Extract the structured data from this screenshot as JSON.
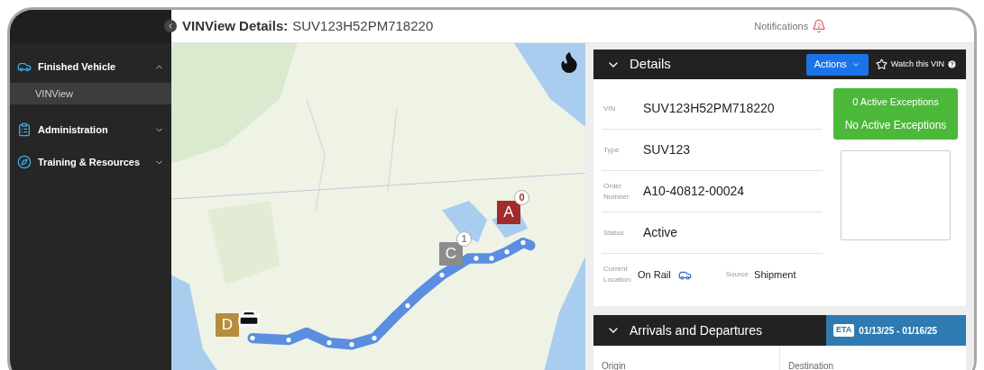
{
  "header": {
    "title": "VINView Details:",
    "vin": "SUV123H52PM718220",
    "notifications": "Notifications",
    "notification_count": "2"
  },
  "sidebar": {
    "items": [
      {
        "label": "Finished Vehicle",
        "expanded": true,
        "children": [
          {
            "label": "VINView",
            "selected": true
          }
        ]
      },
      {
        "label": "Administration",
        "expanded": false
      },
      {
        "label": "Training & Resources",
        "expanded": false
      }
    ]
  },
  "map": {
    "kind": "picture",
    "markers": [
      {
        "label": "A",
        "badge": "0",
        "color": "#a32b2b"
      },
      {
        "label": "C",
        "badge": "1",
        "color": "#8c8c8c"
      },
      {
        "label": "D",
        "color": "#b58d3d"
      }
    ]
  },
  "details": {
    "title": "Details",
    "actions": "Actions",
    "watch": "Watch this VIN",
    "watched": false,
    "fields": [
      {
        "label": "VIN",
        "value": "SUV123H52PM718220"
      },
      {
        "label": "Type",
        "value": "SUV123"
      },
      {
        "label": "Order Number",
        "value": "A10-40812-00024"
      },
      {
        "label": "Status",
        "value": "Active"
      }
    ],
    "current_location": {
      "label": "Current Location",
      "value": "On Rail"
    },
    "source": {
      "label": "Source",
      "value": "Shipment"
    },
    "exceptions": {
      "count": "0 Active Exceptions",
      "message": "No Active Exceptions"
    }
  },
  "arrivals": {
    "title": "Arrivals and Departures",
    "eta_label": "ETA",
    "eta": "01/13/25 - 01/16/25",
    "columns": [
      "Origin",
      "Destination"
    ]
  }
}
